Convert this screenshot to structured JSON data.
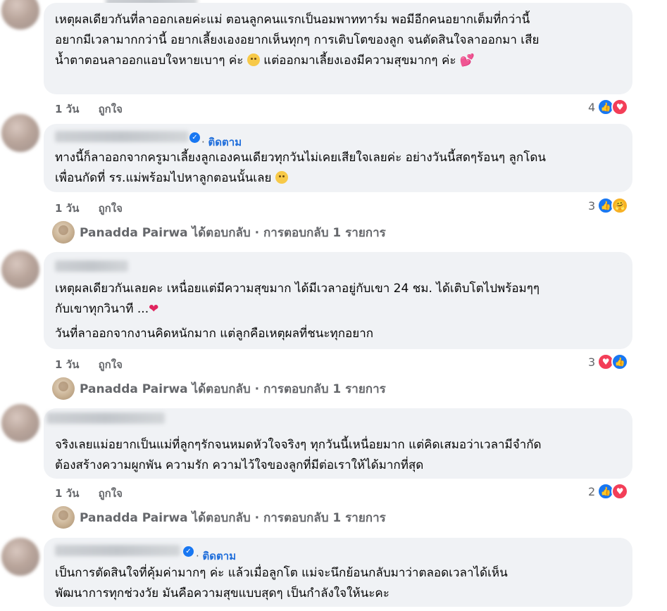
{
  "comments": [
    {
      "lines": [
        "เหตุผลเดียวกันที่ลาออกเลยค่ะแม่ ตอนลูกคนแรกเป็นอมพาททาร์ม พอมีอีกคนอยากเต็มที่กว่านี้",
        "อยากมีเวลามากกว่านี้ อยากเลี้ยงเองอยากเห็นทุกๆ การเติบโตของลูก จนตัดสินใจลาออกมา เสีย"
      ],
      "line3_a": "น้ำตาตอนลาออกแอบใจหายเบาๆ ค่ะ",
      "line3_b": " แต่ออกมาเลี้ยงเองมีความสุขมากๆ ค่ะ",
      "time": "1 วัน",
      "like_label": "ถูกใจ",
      "reaction_count": "4",
      "reactions": [
        "like-icon",
        "love-icon"
      ]
    },
    {
      "follow_label": "ติดตาม",
      "line1": "ทางนี้ก็ลาออกจากครูมาเลี้ยงลูกเองคนเดียวทุกวันไม่เคยเสียใจเลยค่ะ อย่างวันนี้สดๆร้อนๆ ลูกโดน",
      "line2": "เพื่อนกัดที่ รร.แม่พร้อมไปหาลูกตอนนั้นเลย",
      "time": "1 วัน",
      "like_label": "ถูกใจ",
      "reaction_count": "3",
      "reactions": [
        "like-icon",
        "care-icon"
      ],
      "reply_summary": "Panadda Pairwa ได้ตอบกลับ · การตอบกลับ 1 รายการ"
    },
    {
      "line1": "เหตุผลเดียวกันเลยคะ เหนื่อยแต่มีความสุขมาก ได้มีเวลาอยู่กับเขา 24 ชม. ได้เติบโตไปพร้อมๆๆ",
      "line2": "กับเขาทุกวินาที ...",
      "line3": "วันที่ลาออกจากงานคิดหนักมาก แต่ลูกคือเหตุผลที่ชนะทุกอยาก",
      "time": "1 วัน",
      "like_label": "ถูกใจ",
      "reaction_count": "3",
      "reactions": [
        "love-icon",
        "like-icon"
      ],
      "reply_summary": "Panadda Pairwa ได้ตอบกลับ · การตอบกลับ 1 รายการ"
    },
    {
      "line1": "จริงเลยแม่อยากเป็นแม่ที่ลูกๆรักจนหมดหัวใจจริงๆ ทุกวันนี้เหนื่อยมาก แต่คิดเสมอว่าเวลามีจำกัด",
      "line2": "ต้องสร้างความผูกพัน ความรัก ความไว้ใจของลูกที่มีต่อเราให้ได้มากที่สุด",
      "time": "1 วัน",
      "like_label": "ถูกใจ",
      "reaction_count": "2",
      "reactions": [
        "like-icon",
        "love-icon"
      ],
      "reply_summary": "Panadda Pairwa ได้ตอบกลับ · การตอบกลับ 1 รายการ"
    },
    {
      "follow_label": "ติดตาม",
      "line1": "เป็นการตัดสินใจที่คุ้มค่ามากๆ ค่ะ แล้วเมื่อลูกโต แม่จะนึกย้อนกลับมาว่าตลอดเวลาได้เห็น",
      "line2": "พัฒนาการทุกช่วงวัย มันคือความสุขแบบสุดๆ เป็นกำลังใจให้นะคะ"
    }
  ],
  "colors": {
    "bubble_bg": "#f0f2f5",
    "meta_text": "#65676b",
    "link_blue": "#216fdb",
    "like_blue": "#1877f2",
    "love_red": "#f33e58"
  }
}
